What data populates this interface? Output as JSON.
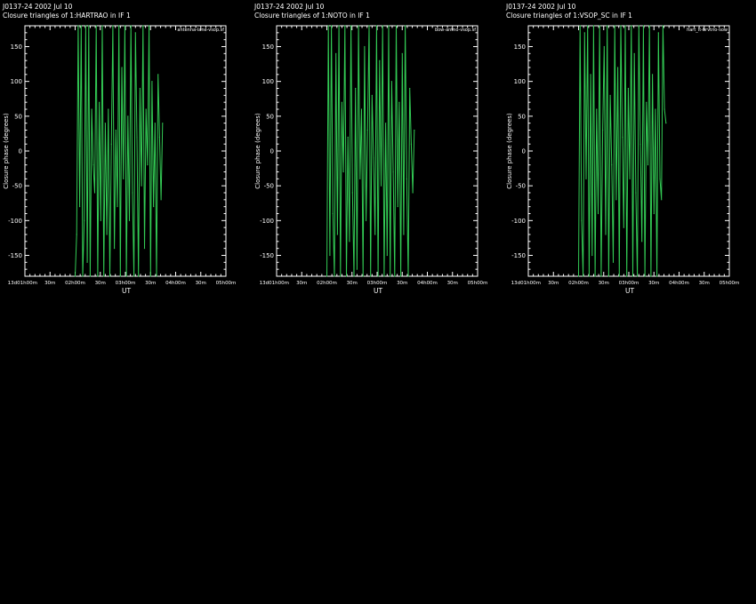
{
  "colors": {
    "background": "#000000",
    "axes": "#ffffff",
    "trace": "#33cc55"
  },
  "plots": [
    {
      "title_line1": "J0137-24  2002 Jul 10",
      "title_line2": "Closure triangles of 1:HARTRAO in IF 1",
      "tag": "antenna-lane-vsop.sf",
      "ylabel": "Closure phase  (degrees)",
      "xlabel": "UT",
      "yticks": [
        "150",
        "100",
        "50",
        "0",
        "-50",
        "-100",
        "-150"
      ],
      "xticks": [
        "13d01h00m",
        "30m",
        "02h00m",
        "30m",
        "03h00m",
        "30m",
        "04h00m",
        "30m",
        "05h00m"
      ],
      "chart_data": {
        "type": "line",
        "title": "Closure triangles of 1:HARTRAO in IF 1",
        "xlabel": "UT",
        "ylabel": "Closure phase  (degrees)",
        "xlim_hours": [
          1.0,
          5.0
        ],
        "ylim": [
          -180,
          180
        ],
        "x_hours": [
          2.0,
          2.03,
          2.06,
          2.09,
          2.12,
          2.15,
          2.18,
          2.21,
          2.24,
          2.27,
          2.3,
          2.33,
          2.36,
          2.39,
          2.42,
          2.45,
          2.48,
          2.51,
          2.54,
          2.57,
          2.6,
          2.63,
          2.66,
          2.69,
          2.72,
          2.75,
          2.78,
          2.81,
          2.84,
          2.87,
          2.9,
          2.93,
          2.96,
          2.99,
          3.02,
          3.05,
          3.08,
          3.11,
          3.14,
          3.17,
          3.2,
          3.23,
          3.26,
          3.29,
          3.32,
          3.35,
          3.38,
          3.41,
          3.44,
          3.47,
          3.5,
          3.53,
          3.56,
          3.59,
          3.62,
          3.65,
          3.68,
          3.71,
          3.74
        ],
        "y": [
          -180,
          -120,
          180,
          -80,
          180,
          -180,
          -100,
          180,
          -160,
          180,
          -180,
          60,
          -20,
          -60,
          180,
          -180,
          70,
          -100,
          180,
          -180,
          40,
          -120,
          60,
          -180,
          10,
          180,
          -140,
          30,
          -80,
          180,
          -180,
          120,
          -40,
          180,
          -180,
          50,
          -100,
          180,
          -60,
          -180,
          170,
          20,
          -180,
          90,
          -50,
          180,
          -140,
          60,
          -20,
          180,
          -180,
          100,
          -80,
          40,
          -180,
          110,
          20,
          -70,
          40
        ]
      }
    },
    {
      "title_line1": "J0137-24  2002 Jul 10",
      "title_line2": "Closure triangles of 1:NOTO in IF 1",
      "tag": "bow-antno-vsop.sf",
      "ylabel": "Closure phase  (degrees)",
      "xlabel": "UT",
      "yticks": [
        "150",
        "100",
        "50",
        "0",
        "-50",
        "-100",
        "-150"
      ],
      "xticks": [
        "13d01h00m",
        "30m",
        "02h00m",
        "30m",
        "03h00m",
        "30m",
        "04h00m",
        "30m",
        "05h00m"
      ],
      "chart_data": {
        "type": "line",
        "title": "Closure triangles of 1:NOTO in IF 1",
        "xlabel": "UT",
        "ylabel": "Closure phase  (degrees)",
        "xlim_hours": [
          1.0,
          5.0
        ],
        "ylim": [
          -180,
          180
        ],
        "x_hours": [
          2.0,
          2.03,
          2.06,
          2.09,
          2.12,
          2.15,
          2.18,
          2.21,
          2.24,
          2.27,
          2.3,
          2.33,
          2.36,
          2.39,
          2.42,
          2.45,
          2.48,
          2.51,
          2.54,
          2.57,
          2.6,
          2.63,
          2.66,
          2.69,
          2.72,
          2.75,
          2.78,
          2.81,
          2.84,
          2.87,
          2.9,
          2.93,
          2.96,
          2.99,
          3.02,
          3.05,
          3.08,
          3.11,
          3.14,
          3.17,
          3.2,
          3.23,
          3.26,
          3.29,
          3.32,
          3.35,
          3.38,
          3.41,
          3.44,
          3.47,
          3.5,
          3.53,
          3.56,
          3.59,
          3.62,
          3.65,
          3.68,
          3.71,
          3.74
        ],
        "y": [
          -180,
          180,
          -150,
          180,
          -90,
          -180,
          140,
          -120,
          180,
          -180,
          70,
          -30,
          180,
          -180,
          20,
          -130,
          180,
          -60,
          -180,
          90,
          -170,
          180,
          -40,
          60,
          -180,
          150,
          -100,
          30,
          180,
          -180,
          80,
          -10,
          -120,
          180,
          -180,
          130,
          -50,
          180,
          -180,
          40,
          -150,
          180,
          -180,
          100,
          -30,
          -180,
          180,
          -80,
          70,
          -180,
          140,
          -120,
          180,
          -40,
          -180,
          90,
          10,
          -60,
          30
        ]
      }
    },
    {
      "title_line1": "J0137-24  2002 Jul 10",
      "title_line2": "Closure triangles of 1:VSOP_SC in IF 1",
      "tag": "hart_lt-brvtno-sow",
      "ylabel": "Closure phase  (degrees)",
      "xlabel": "UT",
      "yticks": [
        "150",
        "100",
        "50",
        "0",
        "-50",
        "-100",
        "-150"
      ],
      "xticks": [
        "13d01h00m",
        "30m",
        "02h00m",
        "30m",
        "03h00m",
        "30m",
        "04h00m",
        "30m",
        "05h00m"
      ],
      "chart_data": {
        "type": "line",
        "title": "Closure triangles of 1:VSOP_SC in IF 1",
        "xlabel": "UT",
        "ylabel": "Closure phase  (degrees)",
        "xlim_hours": [
          1.0,
          5.0
        ],
        "ylim": [
          -180,
          180
        ],
        "x_hours": [
          2.0,
          2.03,
          2.06,
          2.09,
          2.12,
          2.15,
          2.18,
          2.21,
          2.24,
          2.27,
          2.3,
          2.33,
          2.36,
          2.39,
          2.42,
          2.45,
          2.48,
          2.51,
          2.54,
          2.57,
          2.6,
          2.63,
          2.66,
          2.69,
          2.72,
          2.75,
          2.78,
          2.81,
          2.84,
          2.87,
          2.9,
          2.93,
          2.96,
          2.99,
          3.02,
          3.05,
          3.08,
          3.11,
          3.14,
          3.17,
          3.2,
          3.23,
          3.26,
          3.29,
          3.32,
          3.35,
          3.38,
          3.41,
          3.44,
          3.47,
          3.5,
          3.53,
          3.56,
          3.59,
          3.62,
          3.65,
          3.68,
          3.71,
          3.74
        ],
        "y": [
          -180,
          180,
          -100,
          -180,
          170,
          -40,
          180,
          -180,
          110,
          -150,
          180,
          -180,
          60,
          -90,
          180,
          -180,
          30,
          150,
          -120,
          180,
          -180,
          80,
          -20,
          -160,
          180,
          -70,
          120,
          -180,
          180,
          20,
          -110,
          180,
          -180,
          90,
          -40,
          180,
          -180,
          140,
          -60,
          -180,
          180,
          10,
          -130,
          180,
          -180,
          70,
          -20,
          180,
          -180,
          110,
          -90,
          60,
          -180,
          170,
          -40,
          -70,
          180,
          60,
          40
        ]
      }
    }
  ]
}
